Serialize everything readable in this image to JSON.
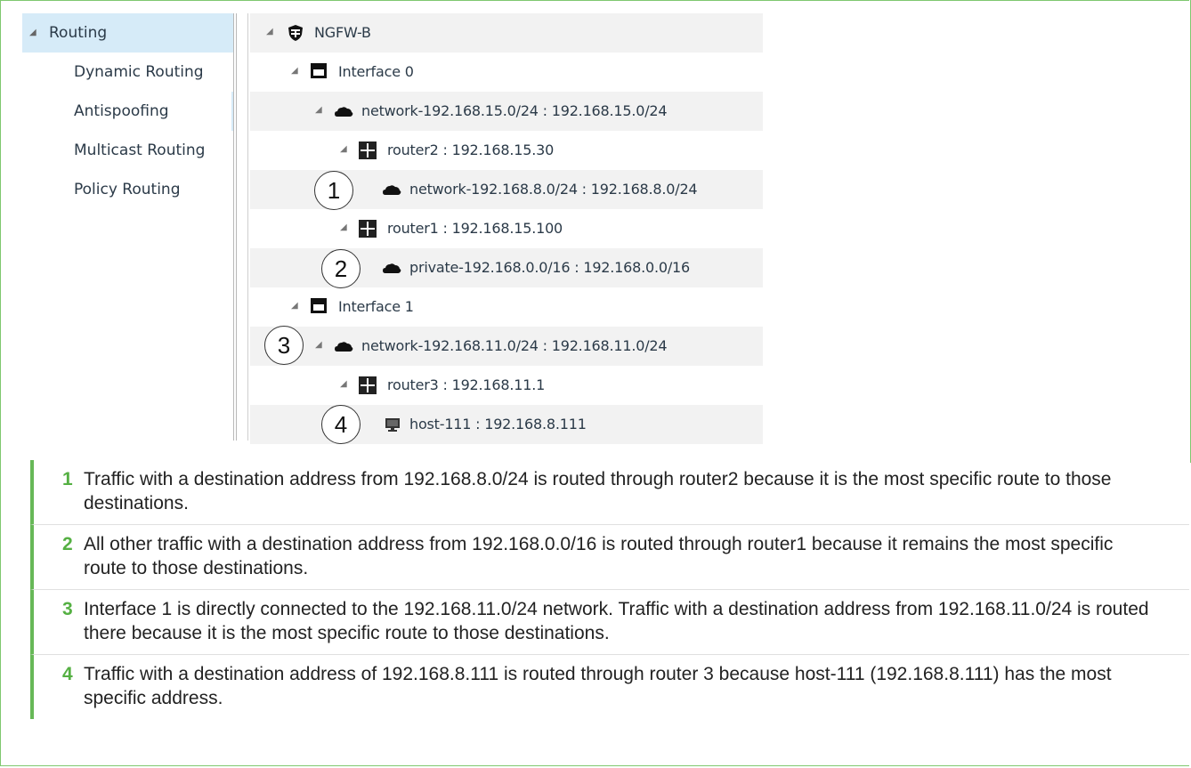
{
  "nav": {
    "items": [
      {
        "label": "Routing",
        "expanded": true,
        "selected": true
      },
      {
        "label": "Dynamic Routing"
      },
      {
        "label": "Antispoofing"
      },
      {
        "label": "Multicast Routing"
      },
      {
        "label": "Policy Routing"
      }
    ]
  },
  "tree": {
    "rows": [
      {
        "label": "NGFW-B",
        "icon": "firewall-shield-icon"
      },
      {
        "label": "Interface 0",
        "icon": "interface-icon"
      },
      {
        "label": "network-192.168.15.0/24 : 192.168.15.0/24",
        "icon": "cloud-network-icon"
      },
      {
        "label": "router2 : 192.168.15.30",
        "icon": "router-icon"
      },
      {
        "label": "network-192.168.8.0/24 : 192.168.8.0/24",
        "icon": "cloud-network-icon"
      },
      {
        "label": "router1 : 192.168.15.100",
        "icon": "router-icon"
      },
      {
        "label": "private-192.168.0.0/16 : 192.168.0.0/16",
        "icon": "cloud-network-icon"
      },
      {
        "label": "Interface 1",
        "icon": "interface-icon"
      },
      {
        "label": "network-192.168.11.0/24 : 192.168.11.0/24",
        "icon": "cloud-network-icon"
      },
      {
        "label": "router3 : 192.168.11.1",
        "icon": "router-icon"
      },
      {
        "label": "host-111 : 192.168.8.111",
        "icon": "host-monitor-icon"
      }
    ]
  },
  "callouts": [
    "1",
    "2",
    "3",
    "4"
  ],
  "notes": [
    {
      "num": "1",
      "text": "Traffic with a destination address from 192.168.8.0/24 is routed through router2 because it is the most specific route to those destinations."
    },
    {
      "num": "2",
      "text": "All other traffic with a destination address from 192.168.0.0/16 is routed through router1 because it remains the most specific route to those destinations."
    },
    {
      "num": "3",
      "text": "Interface 1 is directly connected to the 192.168.11.0/24 network. Traffic with a destination address from 192.168.11.0/24 is routed there because it is the most specific route to those destinations."
    },
    {
      "num": "4",
      "text": "Traffic with a destination address of 192.168.8.111 is routed through router 3 because host-111 (192.168.8.111) has the most specific address."
    }
  ],
  "colors": {
    "accent": "#55b043",
    "selected_bg": "#d6ebf8",
    "frame": "#7fc86f"
  }
}
